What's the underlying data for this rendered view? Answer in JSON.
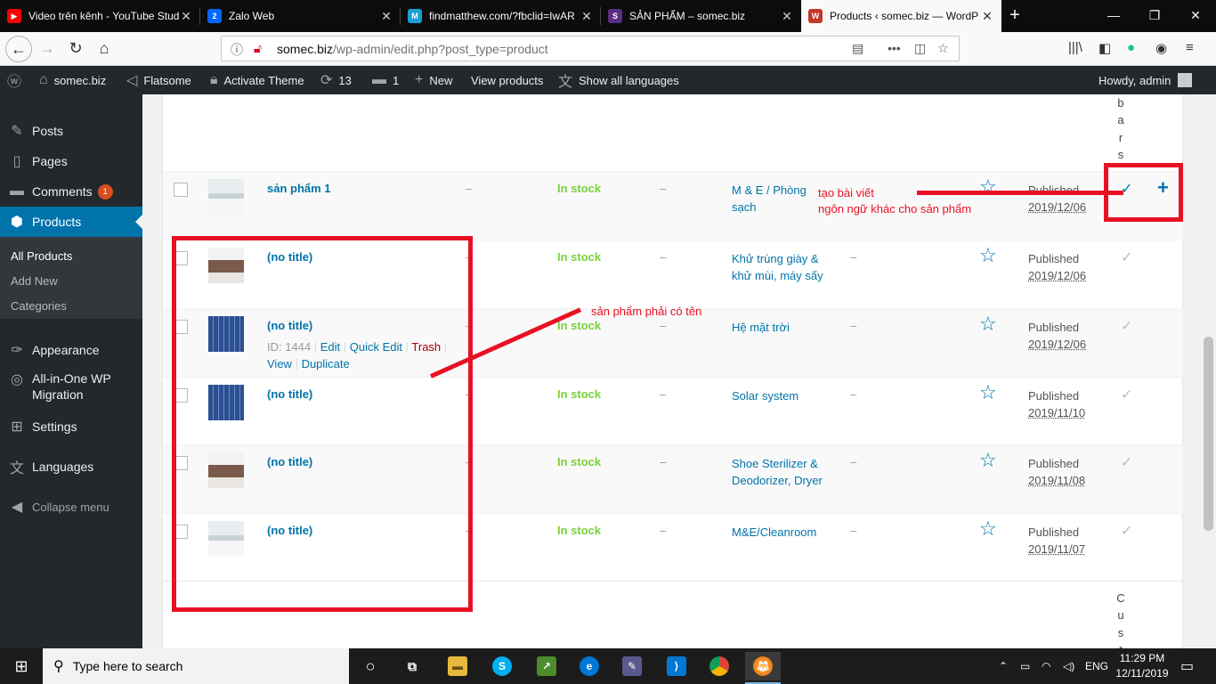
{
  "browser": {
    "tabs": [
      {
        "label": "Video trên kênh - YouTube Stud",
        "fav_color": "#ff0000",
        "fav_text": "▶"
      },
      {
        "label": "Zalo Web",
        "fav_color": "#d0021b",
        "fav_text": "2"
      },
      {
        "label": "findmatthew.com/?fbclid=IwAR",
        "fav_color": "#1a9fd8",
        "fav_text": "M"
      },
      {
        "label": "SẢN PHẨM – somec.biz",
        "fav_color": "#5a2d82",
        "fav_text": "S"
      },
      {
        "label": "Products ‹ somec.biz — WordP",
        "fav_color": "#c0392b",
        "fav_text": "W"
      }
    ],
    "url_host": "somec.biz",
    "url_path": "/wp-admin/edit.php?post_type=product"
  },
  "adminbar": {
    "site": "somec.biz",
    "theme": "Flatsome",
    "activate": "Activate Theme",
    "updates": "13",
    "comments": "1",
    "new": "New",
    "view_products": "View products",
    "languages": "Show all languages",
    "howdy": "Howdy, admin"
  },
  "sidebar": {
    "items": [
      {
        "label": "Posts",
        "icon": "pin-icon"
      },
      {
        "label": "Pages",
        "icon": "pages-icon"
      },
      {
        "label": "Comments",
        "icon": "comment-icon",
        "badge": "1"
      },
      {
        "label": "Products",
        "icon": "box-icon"
      }
    ],
    "sub": [
      "All Products",
      "Add New",
      "Categories"
    ],
    "lower": [
      {
        "label": "Appearance",
        "icon": "brush-icon"
      },
      {
        "label": "All-in-One WP",
        "label2": "Migration",
        "icon": "migration-icon"
      },
      {
        "label": "Settings",
        "icon": "settings-icon"
      },
      {
        "label": "Languages",
        "icon": "translate-icon"
      },
      {
        "label": "Collapse menu",
        "icon": "collapse-icon"
      }
    ]
  },
  "table": {
    "col_letters_top": [
      "b",
      "a",
      "r",
      "s"
    ],
    "col_letters_bottom": [
      "C",
      "u",
      "s",
      "t"
    ],
    "rows": [
      {
        "title": "sản phẩm 1",
        "sku": "–",
        "stock": "In stock",
        "price": "–",
        "cat1": "M & E / Phòng",
        "cat2": "sạch",
        "tags": "",
        "status": "Published",
        "date": "2019/12/06",
        "thumb": "cleanroom"
      },
      {
        "title": "(no title)",
        "sku": "–",
        "stock": "In stock",
        "price": "–",
        "cat1": "Khử trùng giày &",
        "cat2": "khử mùi, máy sấy",
        "tags": "–",
        "status": "Published",
        "date": "2019/12/06",
        "thumb": "shoe"
      },
      {
        "title": "(no title)",
        "sku": "–",
        "stock": "In stock",
        "price": "–",
        "cat1": "Hệ mặt trời",
        "cat2": "",
        "tags": "–",
        "status": "Published",
        "date": "2019/12/06",
        "thumb": "solar"
      },
      {
        "title": "(no title)",
        "sku": "–",
        "stock": "In stock",
        "price": "–",
        "cat1": "Solar system",
        "cat2": "",
        "tags": "–",
        "status": "Published",
        "date": "2019/11/10",
        "thumb": "solar"
      },
      {
        "title": "(no title)",
        "sku": "–",
        "stock": "In stock",
        "price": "–",
        "cat1": "Shoe Sterilizer &",
        "cat2": "Deodorizer, Dryer",
        "tags": "–",
        "status": "Published",
        "date": "2019/11/08",
        "thumb": "shoe"
      },
      {
        "title": "(no title)",
        "sku": "–",
        "stock": "In stock",
        "price": "–",
        "cat1": "M&E/Cleanroom",
        "cat2": "",
        "tags": "–",
        "status": "Published",
        "date": "2019/11/07",
        "thumb": "cleanroom"
      }
    ],
    "row_actions": {
      "id": "ID: 1444",
      "edit": "Edit",
      "quick_edit": "Quick Edit",
      "trash": "Trash",
      "view": "View",
      "duplicate": "Duplicate"
    }
  },
  "annotations": {
    "note1_line1": "tạo bài viết",
    "note1_line2": "ngôn ngữ khác cho sản phẩm",
    "note2": "sản phẩm phải có tên"
  },
  "taskbar": {
    "search_placeholder": "Type here to search",
    "lang": "ENG",
    "time": "11:29 PM",
    "date": "12/11/2019"
  },
  "colors": {
    "wp_blue": "#0073aa",
    "annotation_red": "#e81123",
    "in_stock": "#7ad03a"
  }
}
